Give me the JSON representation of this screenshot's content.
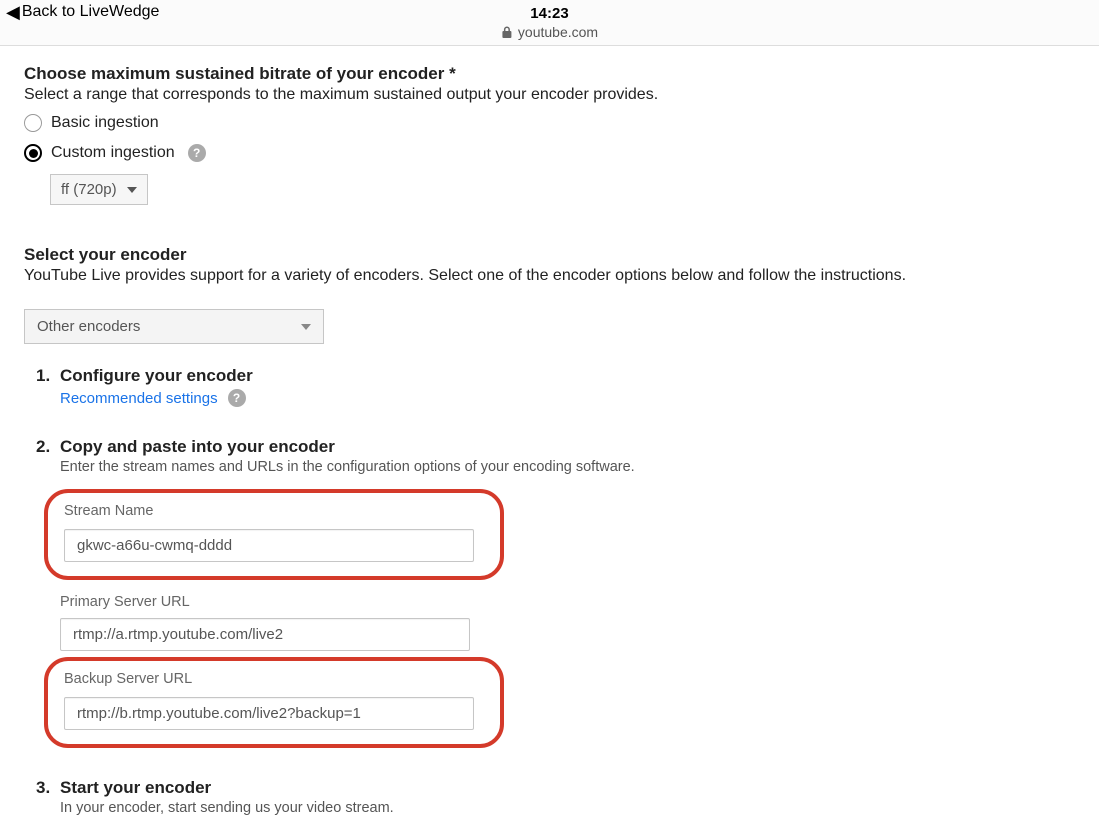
{
  "statusbar": {
    "back_label": "Back to LiveWedge",
    "time": "14:23",
    "url": "youtube.com"
  },
  "bitrate_section": {
    "title": "Choose maximum sustained bitrate of your encoder *",
    "subtitle": "Select a range that corresponds to the maximum sustained output your encoder provides.",
    "basic_label": "Basic ingestion",
    "custom_label": "Custom ingestion",
    "custom_value": "ff (720p)"
  },
  "encoder_section": {
    "title": "Select your encoder",
    "subtitle": "YouTube Live provides support for a variety of encoders. Select one of the encoder options below and follow the instructions.",
    "select_value": "Other encoders"
  },
  "steps": {
    "s1": {
      "title": "Configure your encoder",
      "link": "Recommended settings"
    },
    "s2": {
      "title": "Copy and paste into your encoder",
      "subtitle": "Enter the stream names and URLs in the configuration options of your encoding software.",
      "stream_name_label": "Stream Name",
      "stream_name_value": "gkwc-a66u-cwmq-dddd",
      "primary_label": "Primary Server URL",
      "primary_value": "rtmp://a.rtmp.youtube.com/live2",
      "backup_label": "Backup Server URL",
      "backup_value": "rtmp://b.rtmp.youtube.com/live2?backup=1"
    },
    "s3": {
      "title": "Start your encoder",
      "subtitle": "In your encoder, start sending us your video stream."
    }
  }
}
